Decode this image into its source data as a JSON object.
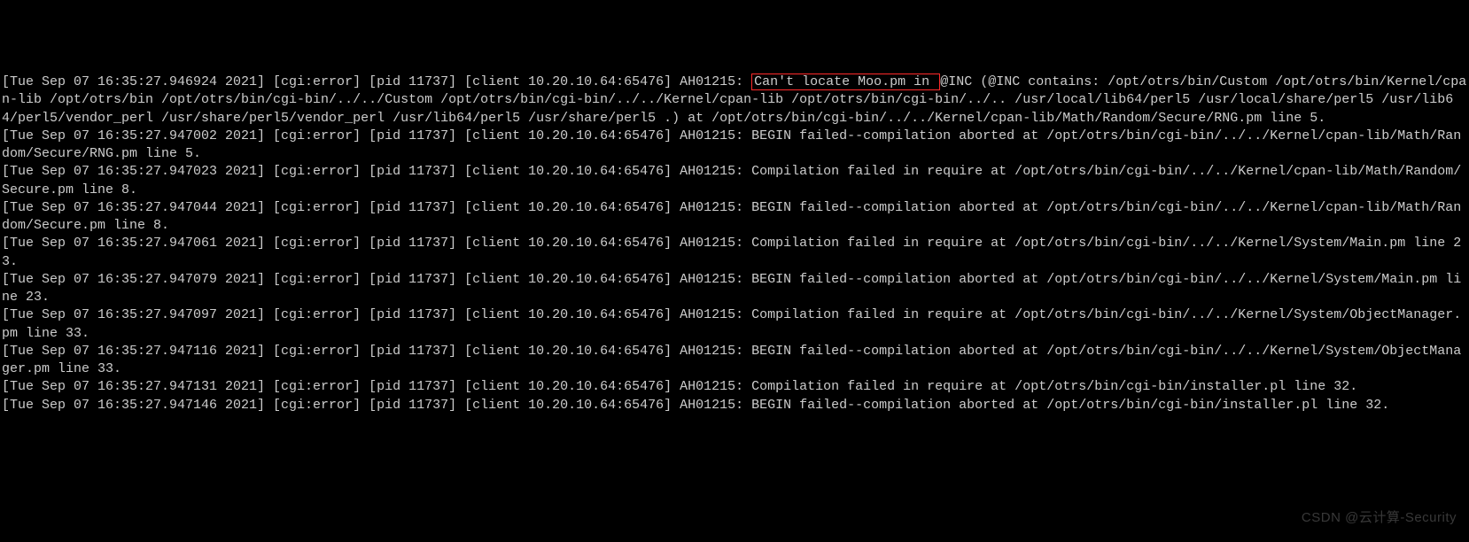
{
  "log": {
    "entries": [
      {
        "prefix": "[Tue Sep 07 16:35:27.946924 2021] [cgi:error] [pid 11737] [client 10.20.10.64:65476] AH01215: ",
        "highlight": "Can't locate Moo.pm in ",
        "suffix": "@INC (@INC contains: /opt/otrs/bin/Custom /opt/otrs/bin/Kernel/cpan-lib /opt/otrs/bin /opt/otrs/bin/cgi-bin/../../Custom /opt/otrs/bin/cgi-bin/../../Kernel/cpan-lib /opt/otrs/bin/cgi-bin/../.. /usr/local/lib64/perl5 /usr/local/share/perl5 /usr/lib64/perl5/vendor_perl /usr/share/perl5/vendor_perl /usr/lib64/perl5 /usr/share/perl5 .) at /opt/otrs/bin/cgi-bin/../../Kernel/cpan-lib/Math/Random/Secure/RNG.pm line 5."
      },
      {
        "text": "[Tue Sep 07 16:35:27.947002 2021] [cgi:error] [pid 11737] [client 10.20.10.64:65476] AH01215: BEGIN failed--compilation aborted at /opt/otrs/bin/cgi-bin/../../Kernel/cpan-lib/Math/Random/Secure/RNG.pm line 5."
      },
      {
        "text": "[Tue Sep 07 16:35:27.947023 2021] [cgi:error] [pid 11737] [client 10.20.10.64:65476] AH01215: Compilation failed in require at /opt/otrs/bin/cgi-bin/../../Kernel/cpan-lib/Math/Random/Secure.pm line 8."
      },
      {
        "text": "[Tue Sep 07 16:35:27.947044 2021] [cgi:error] [pid 11737] [client 10.20.10.64:65476] AH01215: BEGIN failed--compilation aborted at /opt/otrs/bin/cgi-bin/../../Kernel/cpan-lib/Math/Random/Secure.pm line 8."
      },
      {
        "text": "[Tue Sep 07 16:35:27.947061 2021] [cgi:error] [pid 11737] [client 10.20.10.64:65476] AH01215: Compilation failed in require at /opt/otrs/bin/cgi-bin/../../Kernel/System/Main.pm line 23."
      },
      {
        "text": "[Tue Sep 07 16:35:27.947079 2021] [cgi:error] [pid 11737] [client 10.20.10.64:65476] AH01215: BEGIN failed--compilation aborted at /opt/otrs/bin/cgi-bin/../../Kernel/System/Main.pm line 23."
      },
      {
        "text": "[Tue Sep 07 16:35:27.947097 2021] [cgi:error] [pid 11737] [client 10.20.10.64:65476] AH01215: Compilation failed in require at /opt/otrs/bin/cgi-bin/../../Kernel/System/ObjectManager.pm line 33."
      },
      {
        "text": "[Tue Sep 07 16:35:27.947116 2021] [cgi:error] [pid 11737] [client 10.20.10.64:65476] AH01215: BEGIN failed--compilation aborted at /opt/otrs/bin/cgi-bin/../../Kernel/System/ObjectManager.pm line 33."
      },
      {
        "text": "[Tue Sep 07 16:35:27.947131 2021] [cgi:error] [pid 11737] [client 10.20.10.64:65476] AH01215: Compilation failed in require at /opt/otrs/bin/cgi-bin/installer.pl line 32."
      },
      {
        "text": "[Tue Sep 07 16:35:27.947146 2021] [cgi:error] [pid 11737] [client 10.20.10.64:65476] AH01215: BEGIN failed--compilation aborted at /opt/otrs/bin/cgi-bin/installer.pl line 32."
      }
    ]
  },
  "watermark": "CSDN @云计算-Security"
}
